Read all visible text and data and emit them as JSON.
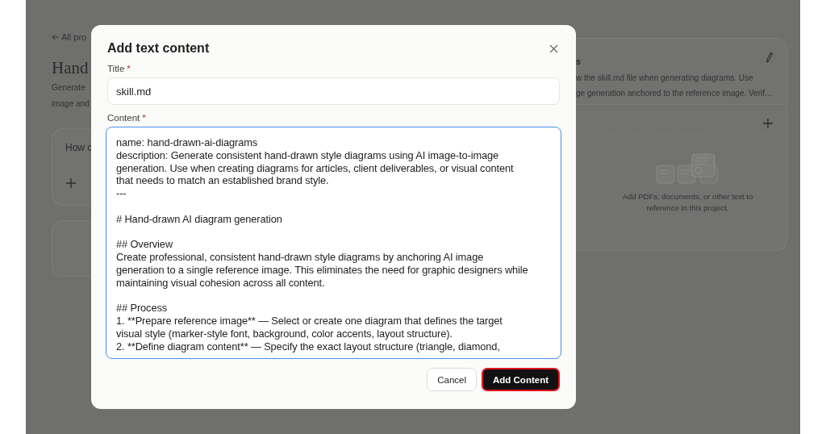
{
  "background_page": {
    "back_link": "All pro",
    "title": "Hand",
    "description_lines": [
      "Generate",
      "image and"
    ],
    "prompt_card": {
      "text": "How c"
    },
    "instructions": {
      "title": "s",
      "description_lines": [
        "w the skill.md file when generating diagrams. Use",
        "ge generation anchored to the reference image. Verif…"
      ]
    },
    "files": {
      "empty_text": "Add PDFs, documents, or other text to reference in this project."
    }
  },
  "dialog": {
    "title": "Add text content",
    "fields": [
      {
        "kind": "input",
        "label": "Title",
        "marker": "*",
        "value": "skill.md",
        "focused": false
      },
      {
        "kind": "textarea",
        "label": "Content",
        "marker": "*",
        "focused": true,
        "blocks": [
          [
            "name: hand-drawn-ai-diagrams",
            "description: Generate consistent hand-drawn style diagrams using AI image-to-image",
            "generation. Use when creating diagrams for articles, client deliverables, or visual content",
            "that needs to match an established brand style.",
            "---"
          ],
          [
            "# Hand-drawn AI diagram generation"
          ],
          [
            "## Overview",
            "Create professional, consistent hand-drawn style diagrams by anchoring AI image",
            "generation to a single reference image. This eliminates the need for graphic designers while",
            "maintaining visual cohesion across all content."
          ],
          [
            "## Process",
            "1. **Prepare reference image** — Select or create one diagram that defines the target",
            "visual style (marker-style font, background, color accents, layout structure).",
            "2. **Define diagram content** — Specify the exact layout structure (triangle, diamond,"
          ]
        ]
      }
    ],
    "buttons": [
      {
        "label": "Cancel",
        "kind": "secondary"
      },
      {
        "label": "Add Content",
        "kind": "primary"
      }
    ]
  }
}
